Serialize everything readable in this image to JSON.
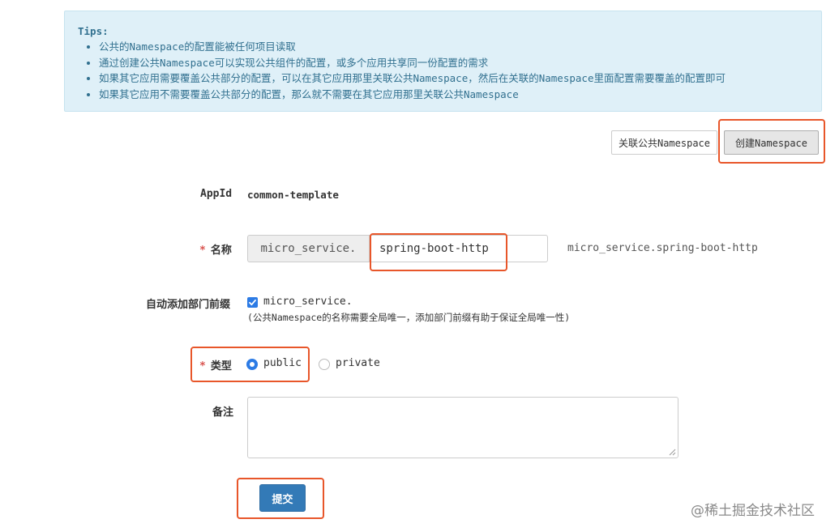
{
  "tips": {
    "title": "Tips:",
    "items": [
      "公共的Namespace的配置能被任何项目读取",
      "通过创建公共Namespace可以实现公共组件的配置，或多个应用共享同一份配置的需求",
      "如果其它应用需要覆盖公共部分的配置，可以在其它应用那里关联公共Namespace，然后在关联的Namespace里面配置需要覆盖的配置即可",
      "如果其它应用不需要覆盖公共部分的配置，那么就不需要在其它应用那里关联公共Namespace"
    ]
  },
  "toolbar": {
    "associate_label": "关联公共Namespace",
    "create_label": "创建Namespace"
  },
  "form": {
    "appid_label": "AppId",
    "appid_value": "common-template",
    "required_mark": "*",
    "name_label": "名称",
    "name_prefix": "micro_service.",
    "name_value": "spring-boot-http",
    "name_preview": "micro_service.spring-boot-http",
    "prefix_label": "自动添加部门前缀",
    "prefix_checkbox_label": "micro_service.",
    "prefix_checked": true,
    "prefix_hint": "(公共Namespace的名称需要全局唯一，添加部门前缀有助于保证全局唯一性)",
    "type_label": "类型",
    "type_options": [
      "public",
      "private"
    ],
    "type_selected": "public",
    "remark_label": "备注",
    "remark_value": "",
    "submit_label": "提交"
  },
  "watermark": "@稀土掘金技术社区",
  "colors": {
    "tips_bg": "#dff0f8",
    "tips_text": "#31708f",
    "primary": "#337ab7",
    "highlight": "#e8562a",
    "required": "#d9534f"
  }
}
